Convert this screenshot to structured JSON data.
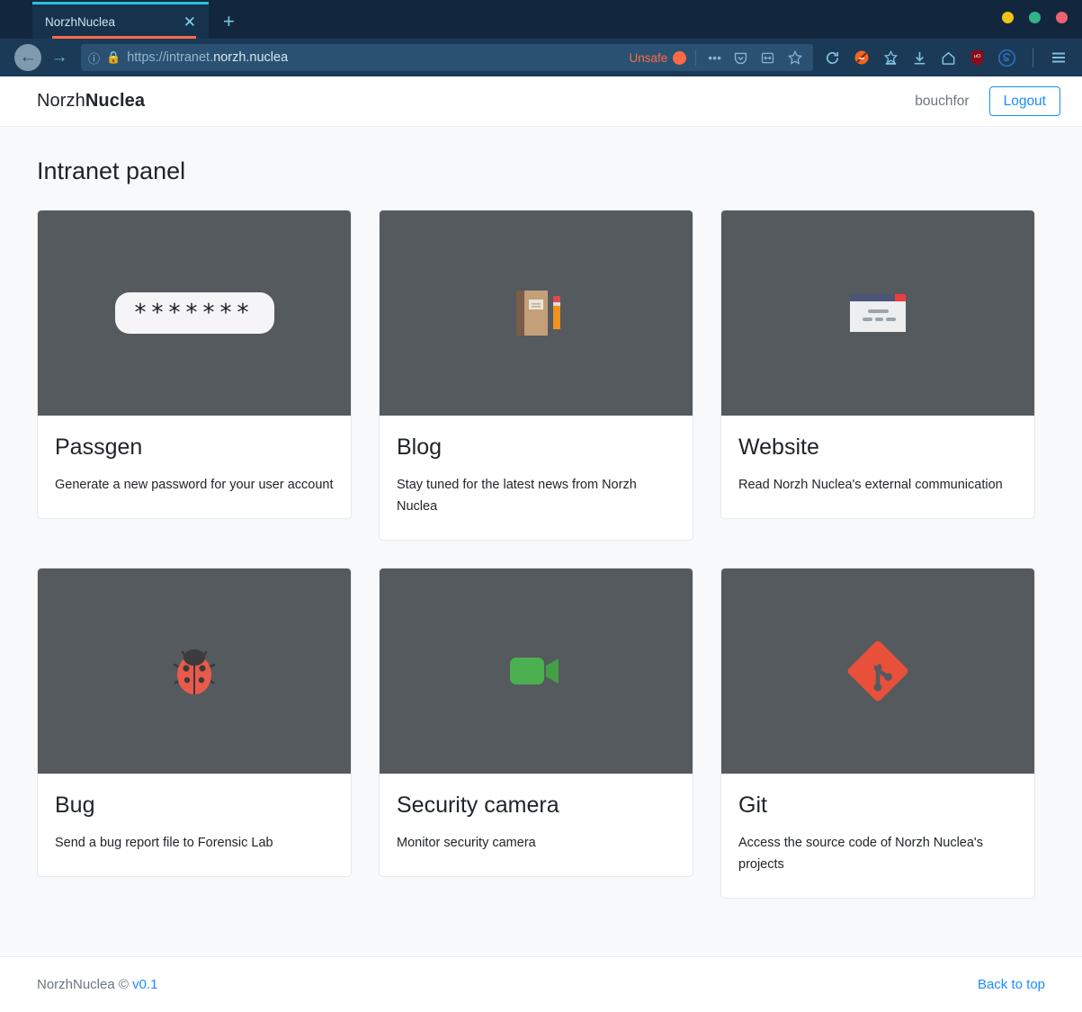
{
  "browser": {
    "tab": {
      "title": "NorzhNuclea",
      "close_icon": "close-icon"
    },
    "new_tab_label": "+",
    "window_controls": [
      {
        "name": "minimize",
        "color": "#f0c419"
      },
      {
        "name": "maximize",
        "color": "#33b387"
      },
      {
        "name": "close",
        "color": "#ef6272"
      }
    ],
    "nav": {
      "back_label": "←",
      "forward_label": "→"
    },
    "url": {
      "scheme": "https://intranet.",
      "domain": "norzh.nuclea",
      "full": "https://intranet.norzh.nuclea"
    },
    "security": {
      "label": "Unsafe"
    },
    "urlbar_icons": [
      "more-icon",
      "pocket-icon",
      "reader-icon",
      "bookmark-star-icon"
    ],
    "toolbar_icons": [
      "reload-icon",
      "noscript-icon",
      "container-icon",
      "downloads-icon",
      "home-icon",
      "ublock-origin-icon",
      "skype-icon",
      "menu-icon"
    ],
    "ublock_label": "uO",
    "skype_label": "S"
  },
  "header": {
    "brand_light": "Norzh",
    "brand_bold": "Nuclea",
    "username": "bouchfor",
    "logout_label": "Logout"
  },
  "main": {
    "page_title": "Intranet panel",
    "cards": [
      {
        "icon": "password-asterisks-icon",
        "icon_text": "*******",
        "title": "Passgen",
        "text": "Generate a new password for your user account"
      },
      {
        "icon": "notebook-pencil-icon",
        "icon_text": "📓",
        "title": "Blog",
        "text": "Stay tuned for the latest news from Norzh Nuclea"
      },
      {
        "icon": "browser-window-icon",
        "icon_text": "🗔",
        "title": "Website",
        "text": "Read Norzh Nuclea's external communication"
      },
      {
        "icon": "ladybug-icon",
        "icon_text": "🐞",
        "title": "Bug",
        "text": "Send a bug report file to Forensic Lab"
      },
      {
        "icon": "video-camera-icon",
        "icon_text": "📹",
        "title": "Security camera",
        "text": "Monitor security camera"
      },
      {
        "icon": "git-logo-icon",
        "icon_text": "",
        "title": "Git",
        "text": "Access the source code of Norzh Nuclea's projects"
      }
    ]
  },
  "footer": {
    "copyright": "NorzhNuclea ©",
    "version": "v0.1",
    "back_to_top": "Back to top"
  },
  "colors": {
    "accent": "#1a8cff",
    "chrome_dark": "#12273d",
    "chrome_nav": "#1b3a57",
    "card_media": "#555a5e",
    "unsafe": "#ff6a45",
    "tab_accent": "#2dc0d8",
    "page_bg": "#f8f9fa",
    "git_red": "#e8503a"
  }
}
